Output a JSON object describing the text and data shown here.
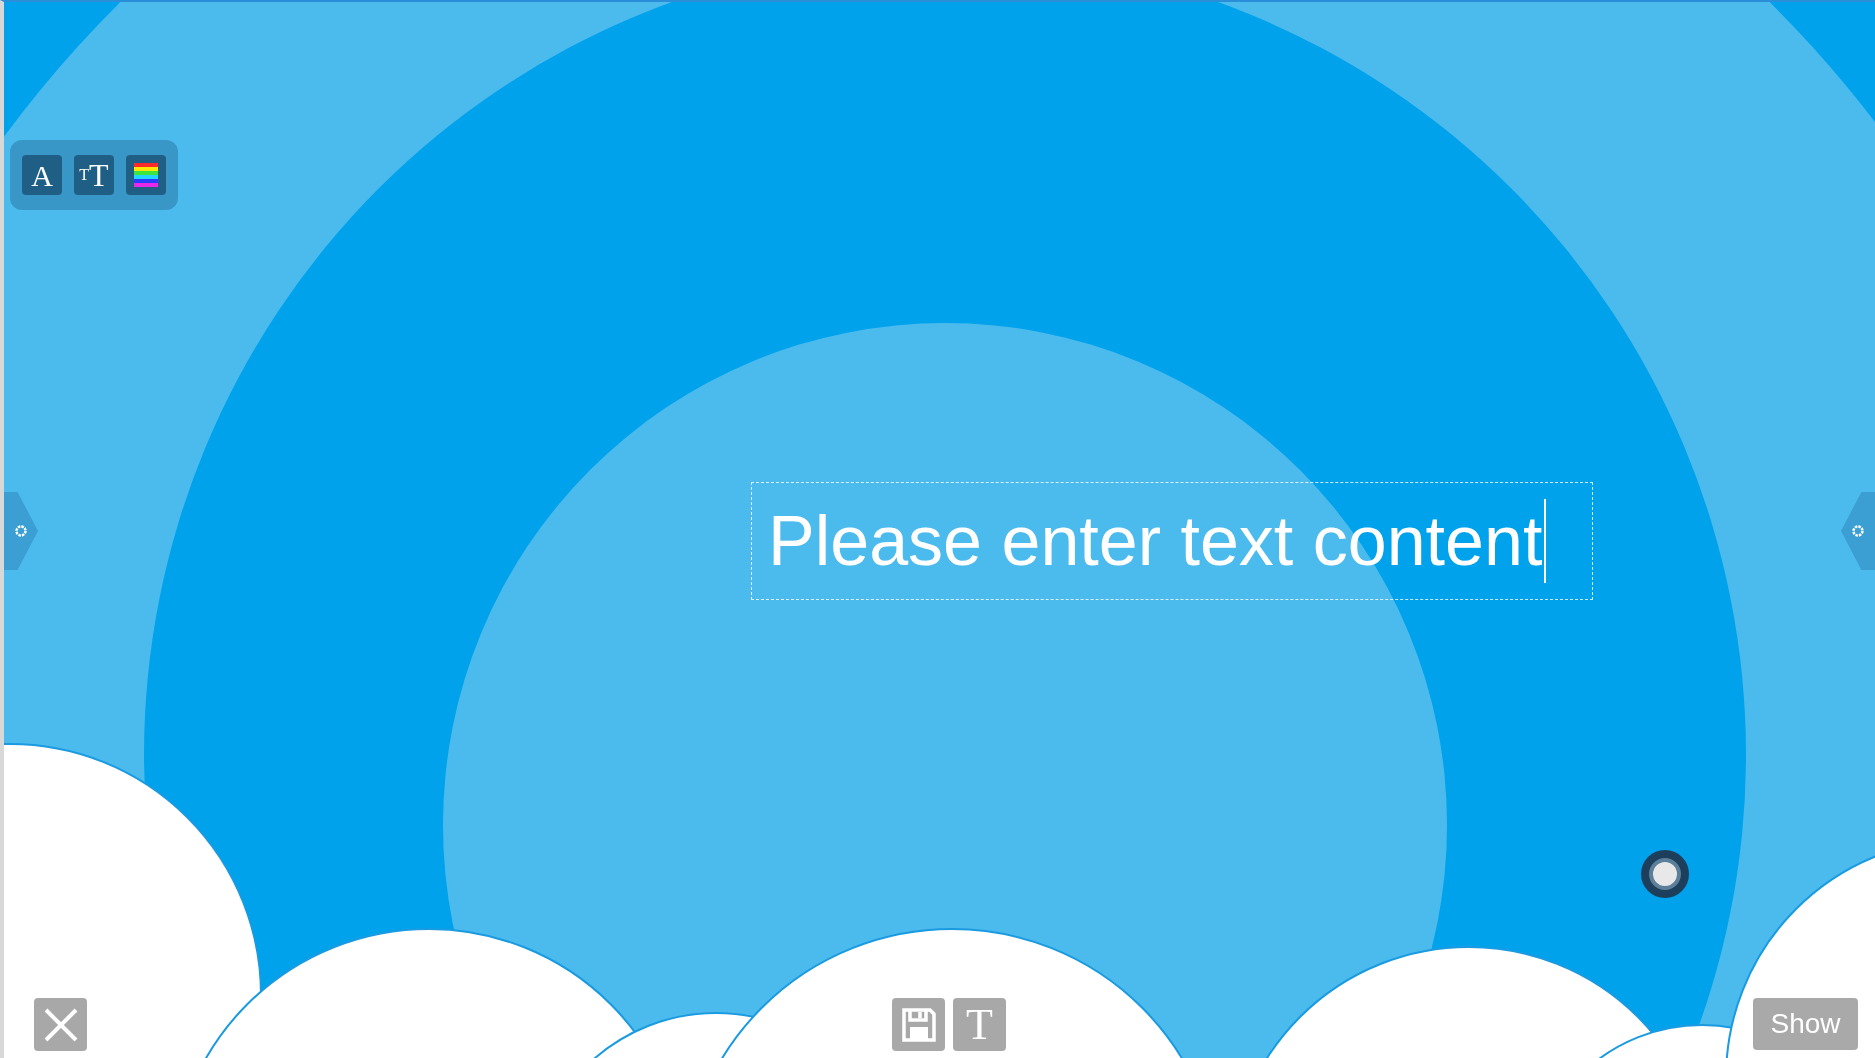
{
  "text_toolbar": [
    {
      "kind": "font",
      "glyph": "A"
    },
    {
      "kind": "size",
      "glyph_small": "T",
      "glyph": "T"
    },
    {
      "kind": "color"
    }
  ],
  "text_box": {
    "text": "Please enter text content",
    "editing": true
  },
  "bottom_toolbar": [
    {
      "kind": "save"
    },
    {
      "kind": "text",
      "glyph": "T"
    }
  ],
  "show_button": {
    "label": "Show"
  }
}
